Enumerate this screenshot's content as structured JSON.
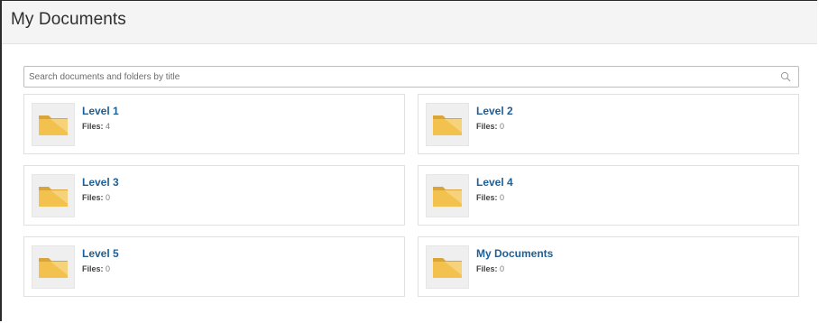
{
  "header": {
    "title": "My Documents"
  },
  "search": {
    "placeholder": "Search documents and folders by title",
    "value": ""
  },
  "folders": [
    {
      "name": "Level 1",
      "files_label": "Files:",
      "files_count": "4"
    },
    {
      "name": "Level 2",
      "files_label": "Files:",
      "files_count": "0"
    },
    {
      "name": "Level 3",
      "files_label": "Files:",
      "files_count": "0"
    },
    {
      "name": "Level 4",
      "files_label": "Files:",
      "files_count": "0"
    },
    {
      "name": "Level 5",
      "files_label": "Files:",
      "files_count": "0"
    },
    {
      "name": "My Documents",
      "files_label": "Files:",
      "files_count": "0"
    }
  ],
  "icons": {
    "folder": "folder-icon",
    "search": "search-icon"
  },
  "colors": {
    "link": "#1f5f95",
    "folder": "#f2c14e"
  }
}
